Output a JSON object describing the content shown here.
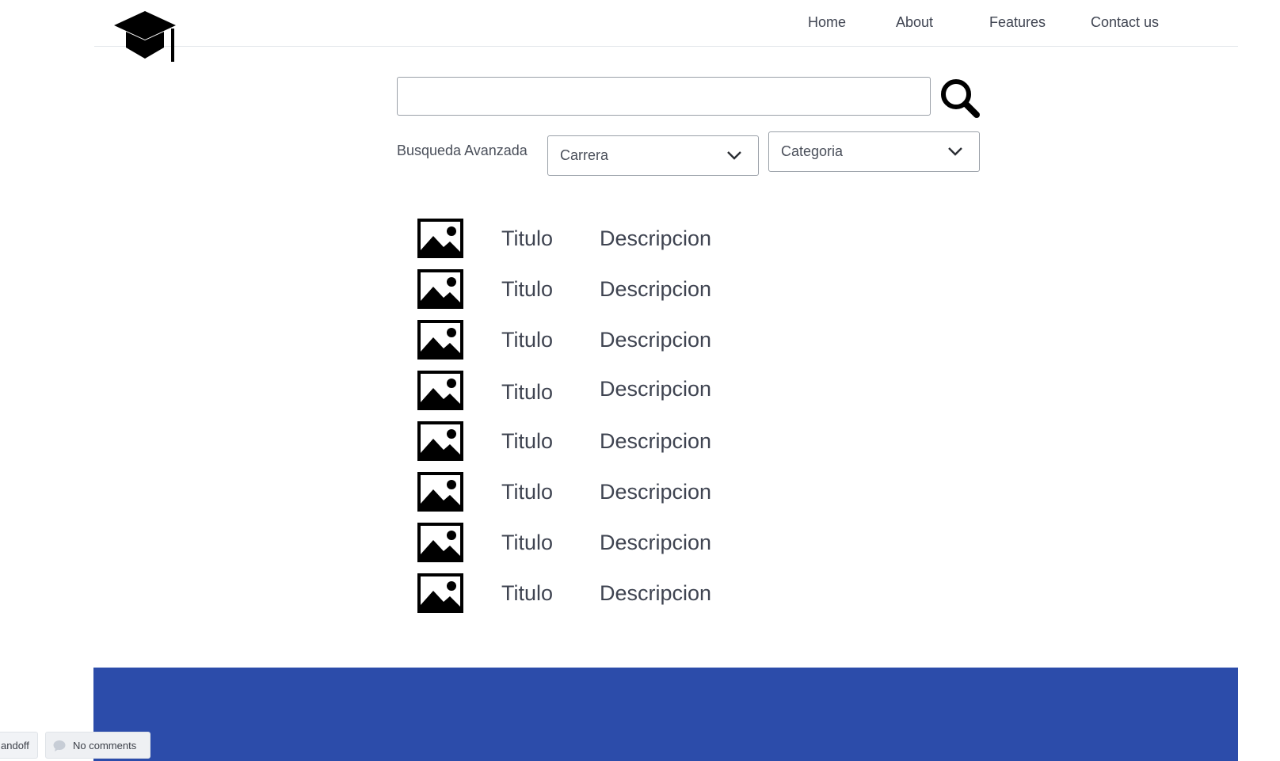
{
  "header": {
    "logo_icon": "graduation-cap-icon",
    "nav": [
      {
        "label": "Home"
      },
      {
        "label": "About"
      },
      {
        "label": "Features"
      },
      {
        "label": "Contact us"
      }
    ]
  },
  "search": {
    "value": "",
    "placeholder": "",
    "button_icon": "search-icon",
    "advanced_label": "Busqueda Avanzada",
    "carrera": {
      "selected": "Carrera",
      "icon": "chevron-down-icon"
    },
    "categoria": {
      "selected": "Categoria",
      "icon": "chevron-down-icon"
    }
  },
  "results": [
    {
      "icon": "image-icon",
      "title": "Titulo",
      "description": "Descripcion"
    },
    {
      "icon": "image-icon",
      "title": "Titulo",
      "description": "Descripcion"
    },
    {
      "icon": "image-icon",
      "title": "Titulo",
      "description": "Descripcion"
    },
    {
      "icon": "image-icon",
      "title": "Titulo",
      "description": "Descripcion"
    },
    {
      "icon": "image-icon",
      "title": "Titulo",
      "description": "Descripcion"
    },
    {
      "icon": "image-icon",
      "title": "Titulo",
      "description": "Descripcion"
    },
    {
      "icon": "image-icon",
      "title": "Titulo",
      "description": "Descripcion"
    },
    {
      "icon": "image-icon",
      "title": "Titulo",
      "description": "Descripcion"
    }
  ],
  "footer": {
    "background": "#2c4caa"
  },
  "overlay": {
    "handoff_label": "andoff",
    "comments_label": "No comments",
    "comments_icon": "comment-bubble-icon"
  }
}
